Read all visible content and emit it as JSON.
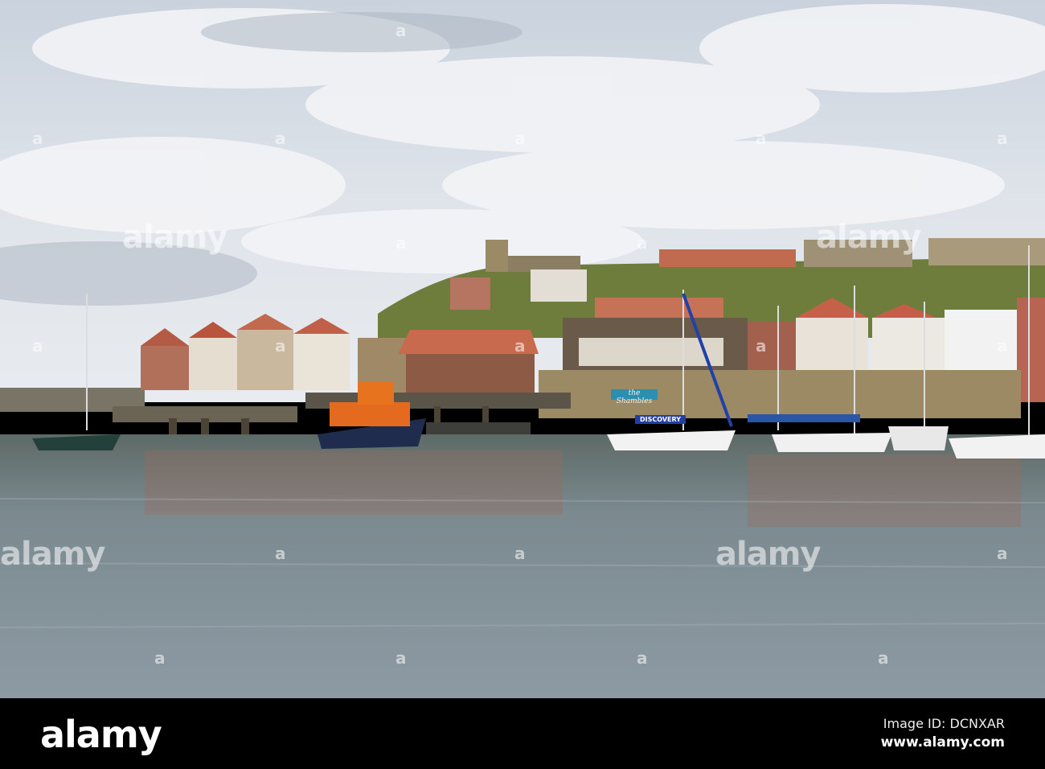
{
  "watermark": {
    "brand": "alamy",
    "mark": "a"
  },
  "signs": {
    "shop": "the Shambles",
    "boat": "DISCOVERY"
  },
  "footer": {
    "logo": "alamy",
    "image_id": "Image ID: DCNXAR",
    "website": "www.alamy.com"
  }
}
